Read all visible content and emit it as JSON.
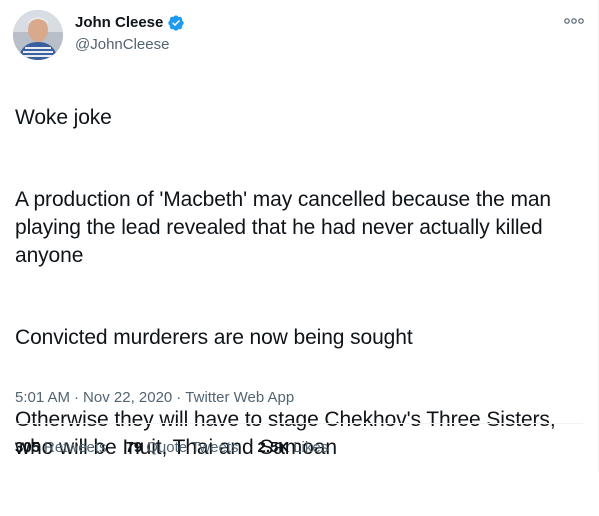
{
  "author": {
    "name": "John Cleese",
    "handle": "@JohnCleese",
    "verified": true
  },
  "tweet": {
    "paragraphs": [
      "Woke joke",
      "A production of 'Macbeth' may cancelled because the man playing the lead revealed that he had never actually killed anyone",
      "Convicted murderers are now being sought",
      "Otherwise they will have to stage Chekhov's Three Sisters, who will be Inuit, Thai and Samoan"
    ]
  },
  "meta": {
    "time": "5:01 AM",
    "date": "Nov 22, 2020",
    "source": "Twitter Web App",
    "separator": "·"
  },
  "stats": {
    "retweets": {
      "count": "305",
      "label": "Retweets"
    },
    "quote_tweets": {
      "count": "79",
      "label": "Quote Tweets"
    },
    "likes": {
      "count": "2.5K",
      "label": "Likes"
    }
  },
  "colors": {
    "verified_badge": "#1d9bf0",
    "secondary_text": "#536471",
    "primary_text": "#0f1419"
  },
  "icons": {
    "more": "more-options-icon",
    "verified": "verified-badge-icon"
  }
}
